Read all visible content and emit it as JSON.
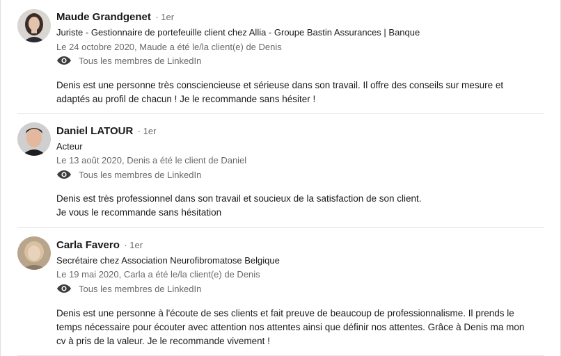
{
  "recommendations": [
    {
      "name": "Maude Grandgenet",
      "degree": "· 1er",
      "headline": "Juriste - Gestionnaire de portefeuille client chez Allia - Groupe Bastin Assurances | Banque",
      "relation": "Le 24 octobre 2020, Maude a été le/la client(e) de Denis",
      "visibility": "Tous les membres de LinkedIn",
      "text_lines": [
        "Denis est une personne très consciencieuse et sérieuse dans son travail. Il offre des conseils sur mesure et",
        "adaptés au profil de chacun ! Je le recommande sans hésiter !"
      ]
    },
    {
      "name": "Daniel LATOUR",
      "degree": "· 1er",
      "headline": "Acteur",
      "relation": "Le 13 août 2020, Denis a été le client de Daniel",
      "visibility": "Tous les membres de LinkedIn",
      "text_lines": [
        "Denis est très professionnel dans son travail et soucieux de la satisfaction de son client.",
        "Je vous le recommande sans hésitation"
      ]
    },
    {
      "name": "Carla Favero",
      "degree": "· 1er",
      "headline": "Secrétaire chez Association Neurofibromatose Belgique",
      "relation": "Le 19 mai 2020, Carla a été le/la client(e) de Denis",
      "visibility": "Tous les membres de LinkedIn",
      "text_lines": [
        "Denis est une personne à l'écoute de ses clients et fait preuve de beaucoup de professionnalisme. Il prends le",
        "temps nécessaire pour écouter avec attention nos attentes ainsi que définir nos attentes. Grâce à Denis ma mon",
        "cv à pris de la valeur. Je le recommande vivement !"
      ]
    }
  ],
  "icons": {
    "visibility": "eye-icon"
  },
  "colors": {
    "divider": "#e6e6e6",
    "muted_text": "#666666"
  }
}
